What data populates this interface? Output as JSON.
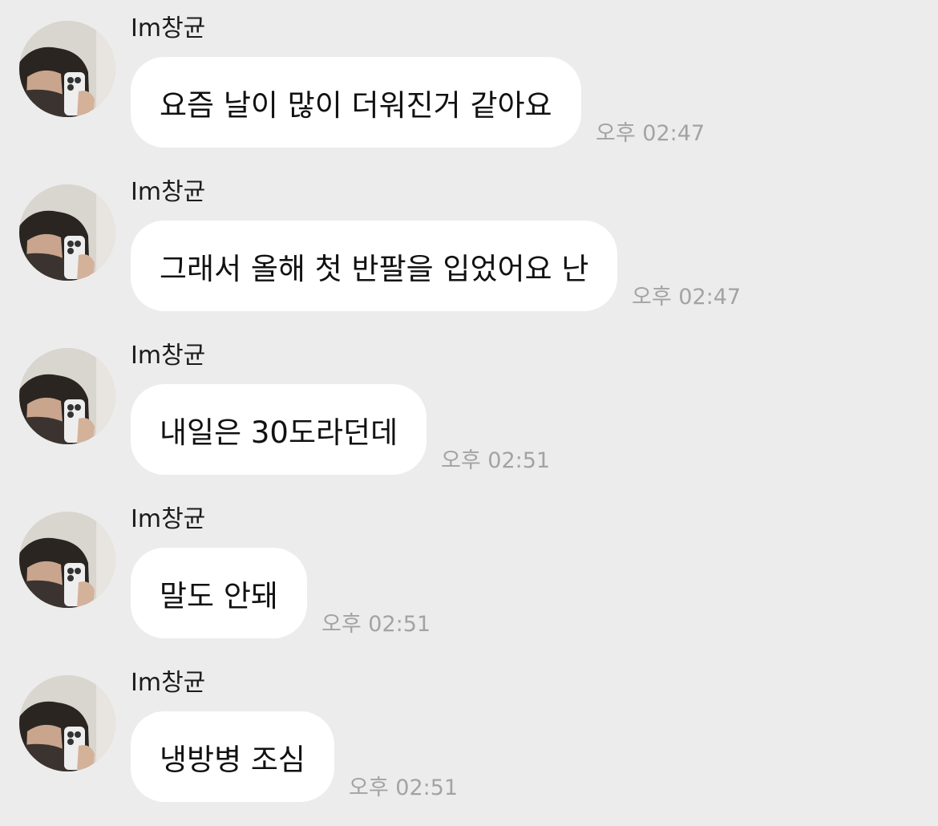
{
  "messages": [
    {
      "sender": "Im창균",
      "text": "요즘 날이 많이 더워진거 같아요",
      "time": "오후 02:47",
      "avatar_icon": "profile-avatar"
    },
    {
      "sender": "Im창균",
      "text": "그래서 올해 첫 반팔을 입었어요 난",
      "time": "오후 02:47",
      "avatar_icon": "profile-avatar"
    },
    {
      "sender": "Im창균",
      "text": "내일은 30도라던데",
      "time": "오후 02:51",
      "avatar_icon": "profile-avatar"
    },
    {
      "sender": "Im창균",
      "text": "말도 안돼",
      "time": "오후 02:51",
      "avatar_icon": "profile-avatar"
    },
    {
      "sender": "Im창균",
      "text": "냉방병 조심",
      "time": "오후 02:51",
      "avatar_icon": "profile-avatar"
    }
  ],
  "colors": {
    "background": "#ececec",
    "bubble": "#ffffff",
    "timestamp": "#a3a3a3",
    "text": "#111111"
  }
}
